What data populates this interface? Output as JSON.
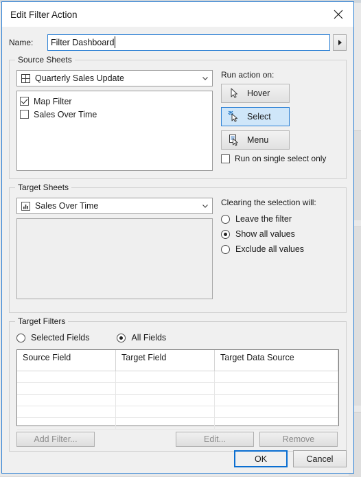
{
  "dialog": {
    "title": "Edit Filter Action",
    "close_icon": "close-icon"
  },
  "name_field": {
    "label": "Name:",
    "value": "Filter Dashboard",
    "placeholder": "",
    "menu_icon": "triangle-right-icon"
  },
  "source_sheets": {
    "legend": "Source Sheets",
    "dropdown": {
      "value": "Quarterly Sales Update",
      "icon": "dashboard-grid-icon",
      "chevron": "chevron-down-icon"
    },
    "items": [
      {
        "label": "Map Filter",
        "checked": true
      },
      {
        "label": "Sales Over Time",
        "checked": false
      }
    ]
  },
  "run_action": {
    "label": "Run action on:",
    "buttons": [
      {
        "label": "Hover",
        "icon": "cursor-arrow-icon",
        "selected": false
      },
      {
        "label": "Select",
        "icon": "cursor-select-icon",
        "selected": true
      },
      {
        "label": "Menu",
        "icon": "cursor-menu-icon",
        "selected": false
      }
    ],
    "single_select": {
      "label": "Run on single select only",
      "checked": false
    }
  },
  "target_sheets": {
    "legend": "Target Sheets",
    "dropdown": {
      "value": "Sales Over Time",
      "icon": "bar-chart-sheet-icon",
      "chevron": "chevron-down-icon"
    },
    "items": []
  },
  "clearing_selection": {
    "label": "Clearing the selection will:",
    "options": [
      {
        "label": "Leave the filter",
        "selected": false
      },
      {
        "label": "Show all values",
        "selected": true
      },
      {
        "label": "Exclude all values",
        "selected": false
      }
    ]
  },
  "target_filters": {
    "legend": "Target Filters",
    "scope_options": [
      {
        "label": "Selected Fields",
        "selected": false
      },
      {
        "label": "All Fields",
        "selected": true
      }
    ],
    "table": {
      "columns": [
        "Source Field",
        "Target Field",
        "Target Data Source"
      ],
      "rows": [],
      "empty_row_count": 5
    },
    "buttons": [
      {
        "label": "Add Filter...",
        "enabled": false
      },
      {
        "label": "Edit...",
        "enabled": false
      },
      {
        "label": "Remove",
        "enabled": false
      }
    ]
  },
  "footer": {
    "ok_label": "OK",
    "cancel_label": "Cancel"
  },
  "colors": {
    "accent_blue": "#2a7fd4",
    "selected_fill": "#cfe6f9",
    "focus_blue": "#0a6ed1",
    "dialog_bg": "#f0f0f0"
  }
}
